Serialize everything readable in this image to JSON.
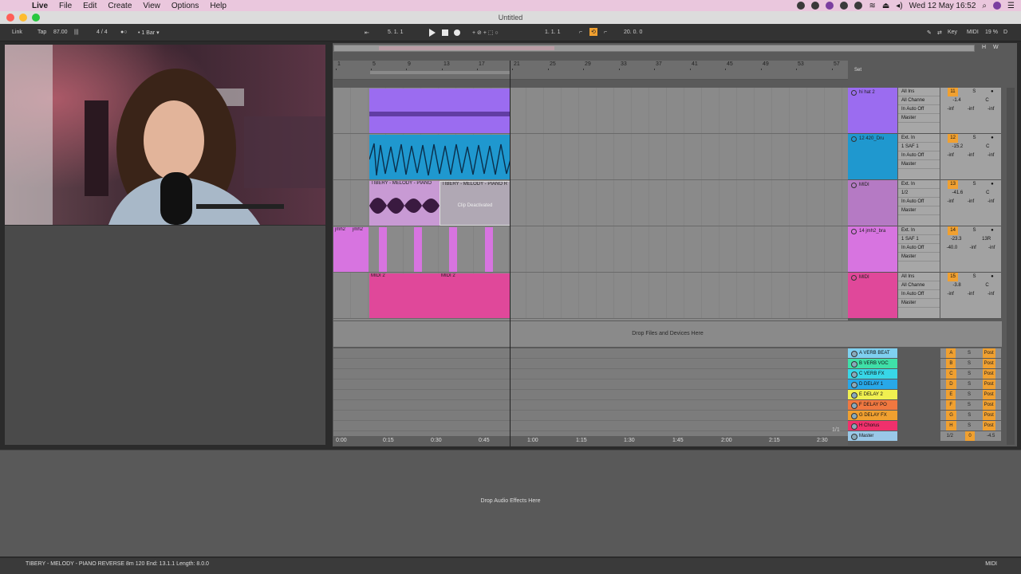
{
  "menubar": {
    "app_menu": "Live",
    "menus": [
      "File",
      "Edit",
      "Create",
      "View",
      "Options",
      "Help"
    ],
    "datetime": "Wed 12 May  16:52"
  },
  "window": {
    "title": "Untitled"
  },
  "transport": {
    "link": "Link",
    "tap": "Tap",
    "tempo": "87.00",
    "meter_icon": "|||",
    "signature": "4 / 4",
    "metronome": "●○",
    "quantize": "1 Bar",
    "arrangement_position": "5.  1.  1",
    "loop_start": "1.  1.  1",
    "loop_length": "20.  0.  0",
    "key_label": "Key",
    "midi_label": "MIDI",
    "cpu": "19 %",
    "d_label": "D"
  },
  "arrangement": {
    "ruler_bars": [
      "1",
      "5",
      "9",
      "13",
      "17",
      "21",
      "25",
      "29",
      "33",
      "37",
      "41",
      "45",
      "49",
      "53",
      "57"
    ],
    "set_label": "Set",
    "overview_h": "H",
    "overview_w": "W",
    "time_marks": [
      "0:00",
      "0:15",
      "0:30",
      "0:45",
      "1:00",
      "1:15",
      "1:30",
      "1:45",
      "2:00",
      "2:15",
      "2:30"
    ],
    "page_indicator": "1/1",
    "drop_text": "Drop Files and Devices Here",
    "tracks": [
      {
        "name": "hi hat 2",
        "color": "#9b6cf0",
        "input": "All Ins",
        "channel": "All Channe",
        "monitor": "In  Auto  Off",
        "output": "Master",
        "number": "11",
        "vol": "-1.4",
        "pan": "C",
        "sends": [
          "-inf",
          "-inf",
          "-inf"
        ]
      },
      {
        "name": "12 420_Dru",
        "color": "#1f98cf",
        "input": "Ext. In",
        "channel": "1 SAF 1",
        "monitor": "In  Auto  Off",
        "output": "Master",
        "number": "12",
        "vol": "-15.2",
        "pan": "C",
        "sends": [
          "-inf",
          "-inf",
          "-inf"
        ]
      },
      {
        "name": "MIDI",
        "color": "#b57ac4",
        "input": "Ext. In",
        "channel": "1/2",
        "monitor": "In  Auto  Off",
        "output": "Master",
        "number": "13",
        "vol": "-41.6",
        "pan": "C",
        "sends": [
          "-inf",
          "-inf",
          "-inf"
        ]
      },
      {
        "name": "14 jmh2_bra",
        "color": "#d774e0",
        "input": "Ext. In",
        "channel": "1 SAF 1",
        "monitor": "In  Auto  Off",
        "output": "Master",
        "number": "14",
        "vol": "-23.3",
        "pan": "13R",
        "sends": [
          "-40.0",
          "-inf",
          "-inf"
        ]
      },
      {
        "name": "MIDI",
        "color": "#e0489a",
        "input": "All Ins",
        "channel": "All Channe",
        "monitor": "In  Auto  Off",
        "output": "Master",
        "number": "15",
        "vol": "-3.8",
        "pan": "C",
        "sends": [
          "-inf",
          "-inf",
          "-inf"
        ]
      }
    ],
    "clips": {
      "melody_a": "TIBERY - MELODY - PIANO",
      "melody_b": "TIBERY - MELODY - PIANO R",
      "deactivated": "Clip Deactivated",
      "jmh": "jmh2",
      "midi2": "MIDI 2"
    },
    "returns": [
      {
        "name": "A VERB BEAT",
        "color": "#7fd0f0",
        "letter": "A"
      },
      {
        "name": "B VERB VOC",
        "color": "#3fe0a8",
        "letter": "B"
      },
      {
        "name": "C VERB FX",
        "color": "#38d7e8",
        "letter": "C"
      },
      {
        "name": "D DELAY 1",
        "color": "#28a8e8",
        "letter": "D"
      },
      {
        "name": "E DELAY 2",
        "color": "#f0f050",
        "letter": "E"
      },
      {
        "name": "F DELAY PO",
        "color": "#f07840",
        "letter": "F"
      },
      {
        "name": "G DELAY FX",
        "color": "#f0a030",
        "letter": "G"
      },
      {
        "name": "H Chorus",
        "color": "#f0306c",
        "letter": "H"
      },
      {
        "name": "Master",
        "color": "#9ac8e8",
        "letter": "0"
      }
    ],
    "master_output": "1/2",
    "master_vol": "-4.5",
    "return_send_s": "S",
    "return_post": "Post"
  },
  "detail": {
    "drop_text": "Drop Audio Effects Here"
  },
  "statusbar": {
    "text": "TIBERY - MELODY - PIANO REVERSE 8m 120  End: 13.1.1  Length: 8.0.0",
    "midi": "MIDI"
  }
}
